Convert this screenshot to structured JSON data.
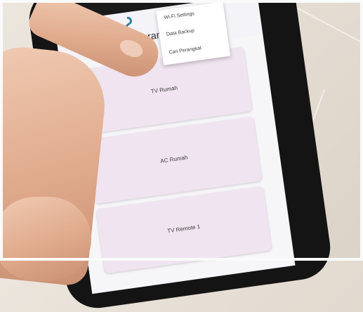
{
  "app": {
    "title": "Daftar Peran"
  },
  "menu": {
    "items": [
      "Wi-Fi Settings",
      "Data Backup",
      "Cari Perangkat"
    ]
  },
  "devices": [
    "TV Rumah",
    "AC Rumah",
    "TV Remote 1"
  ]
}
